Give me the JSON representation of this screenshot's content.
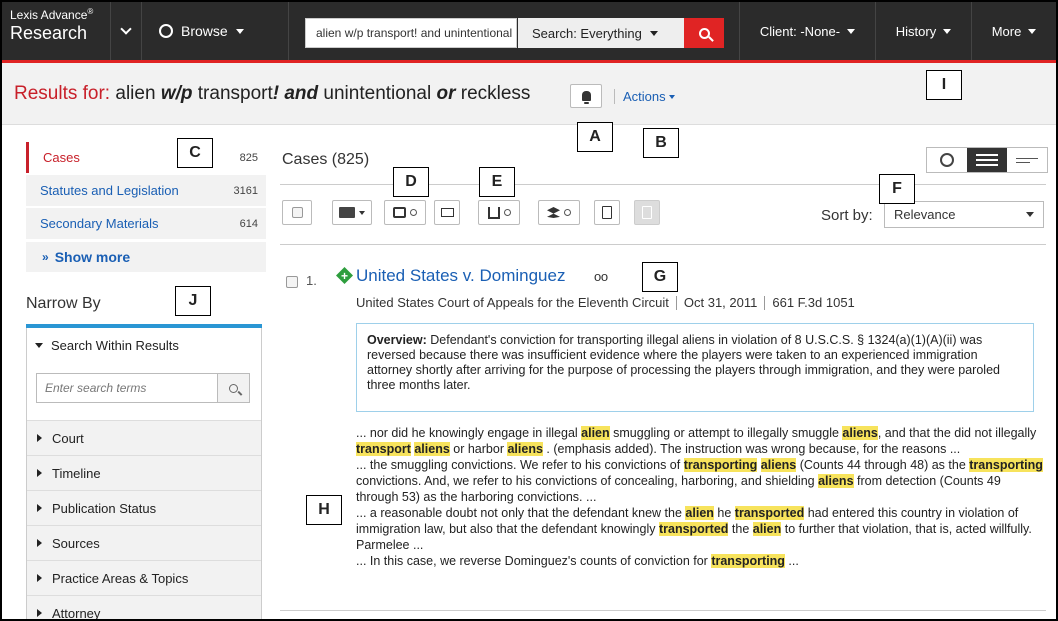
{
  "topbar": {
    "logo_line1": "Lexis Advance",
    "logo_reg": "®",
    "logo_line2": "Research",
    "browse_label": "Browse",
    "search_value": "alien w/p transport! and unintentional or reckless",
    "search_scope": "Search: Everything",
    "client_label": "Client: -None-",
    "history_label": "History",
    "more_label": "More"
  },
  "results_header": {
    "prefix": "Results for:",
    "q_alien": "alien",
    "q_wp": "w/p",
    "q_transport": "transport",
    "q_bang": "!",
    "q_and": "and",
    "q_unintentional": "unintentional",
    "q_or": "or",
    "q_reckless": "reckless",
    "actions_label": "Actions"
  },
  "callouts": {
    "a": "A",
    "b": "B",
    "c": "C",
    "d": "D",
    "e": "E",
    "f": "F",
    "g": "G",
    "h": "H",
    "i": "I",
    "j": "J"
  },
  "sidebar": {
    "categories": [
      {
        "name": "Cases",
        "count": "825"
      },
      {
        "name": "Statutes and Legislation",
        "count": "3161"
      },
      {
        "name": "Secondary Materials",
        "count": "614"
      }
    ],
    "show_more": "Show more",
    "narrow_by": "Narrow By",
    "search_within": "Search Within Results",
    "search_placeholder": "Enter search terms",
    "filters": [
      "Court",
      "Timeline",
      "Publication Status",
      "Sources",
      "Practice Areas & Topics",
      "Attorney"
    ]
  },
  "main": {
    "cases_title": "Cases (825)",
    "sort_by": "Sort by:",
    "sort_value": "Relevance",
    "result": {
      "number": "1.",
      "title": "United States v. Dominguez",
      "court": "United States Court of Appeals for the Eleventh Circuit",
      "date": "Oct 31, 2011",
      "citation": "661 F.3d 1051",
      "overview_label": "Overview:",
      "overview_text": "Defendant's conviction for transporting illegal aliens in violation of 8 U.S.C.S. § 1324(a)(1)(A)(ii) was reversed because there was insufficient evidence where the players were taken to an experienced immigration attorney shortly after arriving for the purpose of processing the players through immigration, and they were paroled three months later."
    },
    "snippets": {
      "s1a": "... nor did he knowingly engage in illegal ",
      "s1b": "alien",
      "s1c": " smuggling or attempt to illegally smuggle ",
      "s1d": "aliens",
      "s1e": ", and that the did not illegally ",
      "s1f": "transport",
      "s1g": " ",
      "s1h": "aliens",
      "s1i": " or harbor ",
      "s1j": "aliens",
      "s1k": " . (emphasis added). The instruction was wrong because, for the reasons ...",
      "s2a": "... the smuggling convictions. We refer to his convictions of ",
      "s2b": "transporting",
      "s2c": " ",
      "s2d": "aliens",
      "s2e": " (Counts 44 through 48) as the ",
      "s2f": "transporting",
      "s2g": " convictions. And, we refer to his convictions of concealing, harboring, and shielding ",
      "s2h": "aliens",
      "s2i": " from detection (Counts 49 through 53) as the harboring convictions. ...",
      "s3a": "... a reasonable doubt not only that the defendant knew the ",
      "s3b": "alien",
      "s3c": " he ",
      "s3d": "transported",
      "s3e": " had entered this country in violation of immigration law, but also that the defendant knowingly ",
      "s3f": "transported",
      "s3g": " the ",
      "s3h": "alien",
      "s3i": " to further that violation, that is, acted willfully. Parmelee ...",
      "s4a": "... In this case, we reverse Dominguez's counts of conviction for ",
      "s4b": "transporting",
      "s4c": " ..."
    }
  },
  "colors": {
    "topbar_bg": "#2b2b2b",
    "accent_red": "#e02424",
    "link_blue": "#1a5fb4",
    "highlight": "#f7e35c",
    "narrow_bar": "#2a96d4"
  }
}
